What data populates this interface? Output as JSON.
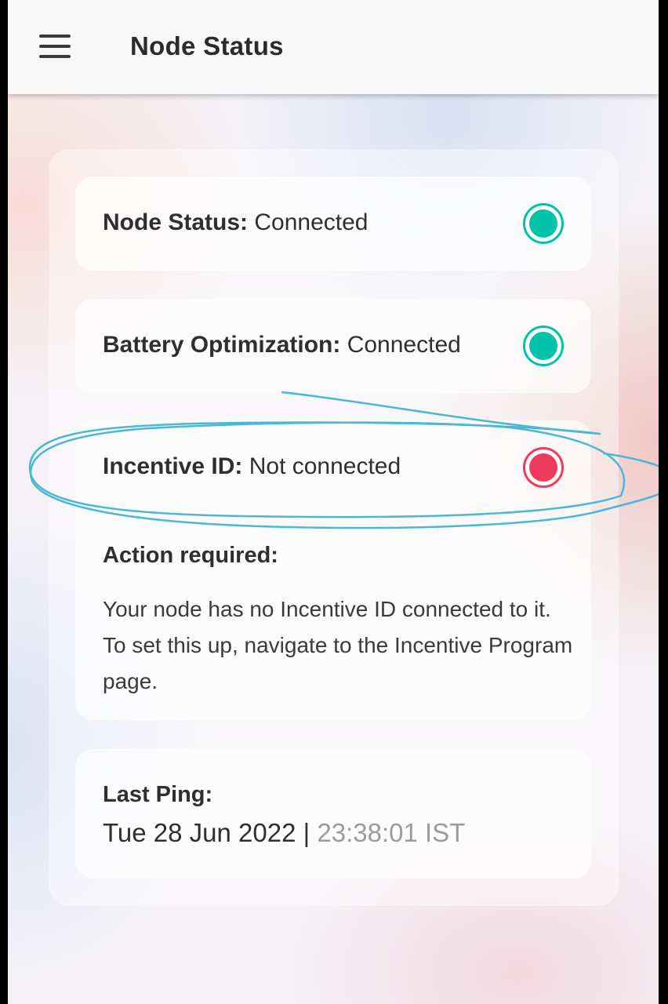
{
  "app_bar": {
    "title": "Node Status",
    "menu_icon": "hamburger-menu-icon"
  },
  "status_items": [
    {
      "label": "Node Status:",
      "value": "Connected",
      "status": "connected",
      "color": "#00c2a8"
    },
    {
      "label": "Battery Optimization:",
      "value": "Connected",
      "status": "connected",
      "color": "#00c2a8"
    },
    {
      "label": "Incentive ID:",
      "value": "Not connected",
      "status": "not-connected",
      "color": "#ef3b5b"
    }
  ],
  "action": {
    "title": "Action required:",
    "body": "Your node has no Incentive ID connected to it. To set this up, navigate to the Incentive Program page."
  },
  "last_ping": {
    "label": "Last Ping:",
    "date": "Tue 28 Jun 2022 |",
    "time": "23:38:01 IST"
  },
  "colors": {
    "connected": "#00c2a8",
    "not_connected": "#ef3b5b",
    "annotation_stroke": "#4ab8d4"
  }
}
